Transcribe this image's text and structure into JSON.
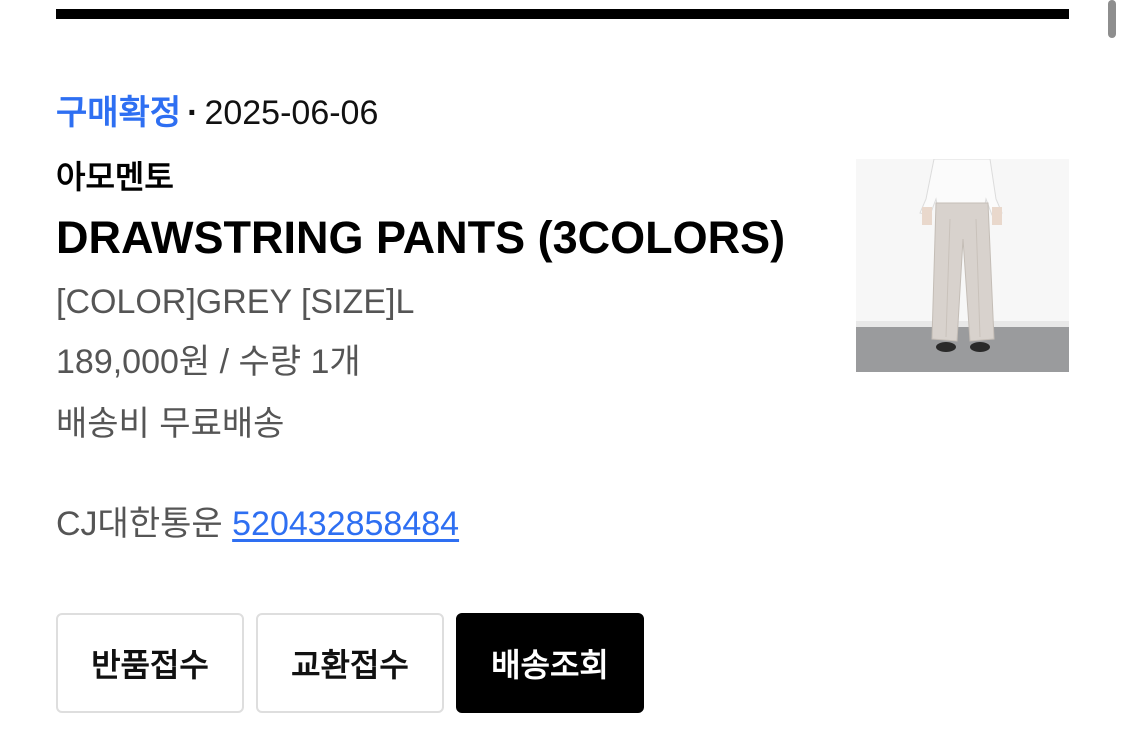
{
  "order": {
    "status": "구매확정",
    "separator": "·",
    "date": "2025-06-06",
    "brand": "아모멘토",
    "product_name": "DRAWSTRING PANTS (3COLORS)",
    "option": "[COLOR]GREY [SIZE]L",
    "price_qty": "189,000원 / 수량 1개",
    "shipping_fee": "배송비 무료배송",
    "carrier": "CJ대한통운",
    "tracking_number": "520432858484"
  },
  "actions": {
    "return_label": "반품접수",
    "exchange_label": "교환접수",
    "track_label": "배송조회"
  },
  "colors": {
    "accent": "#2e6ff2",
    "muted_text": "#555555",
    "primary_button": "#000000"
  },
  "icons": {
    "product_thumbnail": "product-photo-drawstring-pants"
  }
}
